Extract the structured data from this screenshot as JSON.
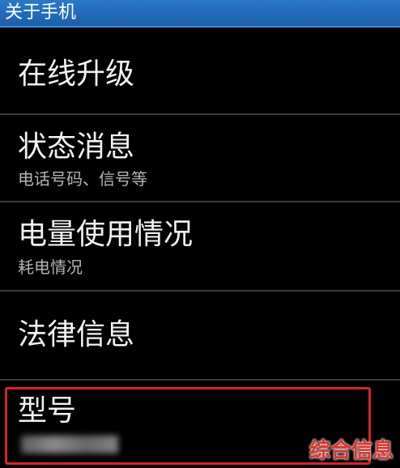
{
  "header": {
    "title": "关于手机"
  },
  "items": [
    {
      "title": "在线升级",
      "subtitle": ""
    },
    {
      "title": "状态消息",
      "subtitle": "电话号码、信号等"
    },
    {
      "title": "电量使用情况",
      "subtitle": "耗电情况"
    },
    {
      "title": "法律信息",
      "subtitle": ""
    },
    {
      "title": "型号",
      "subtitle": ""
    }
  ],
  "watermark": {
    "text": "综合信息"
  },
  "colors": {
    "header": "#1b5fa8",
    "highlight": "#d8232a",
    "background": "#000000"
  }
}
